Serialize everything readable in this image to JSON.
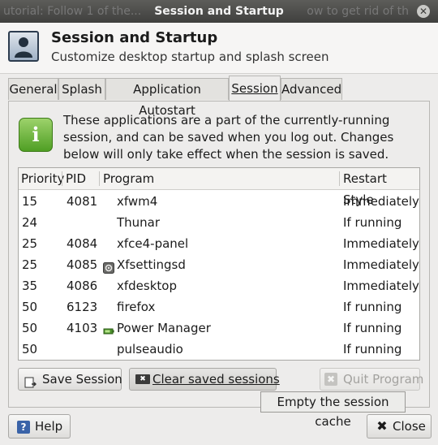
{
  "window": {
    "title": "Session and Startup",
    "behind_left": "utorial: Follow 1 of the...",
    "behind_right": "ow to get rid of th",
    "close_glyph": "✕"
  },
  "header": {
    "title": "Session and Startup",
    "subtitle": "Customize desktop startup and splash screen"
  },
  "tabs": [
    {
      "label": "General",
      "active": false
    },
    {
      "label": "Splash",
      "active": false
    },
    {
      "label": "Application Autostart",
      "active": false
    },
    {
      "label": "Session",
      "active": true
    },
    {
      "label": "Advanced",
      "active": false
    }
  ],
  "info": {
    "icon_glyph": "i",
    "line1": "These applications are a part of the currently-running",
    "line2": "session, and can be saved when you log out.  Changes",
    "line3": "below will only take effect when the session is saved."
  },
  "table": {
    "columns": [
      "Priority",
      "PID",
      "Program",
      "Restart Style"
    ],
    "rows": [
      {
        "priority": "15",
        "pid": "4081",
        "program": "xfwm4",
        "restart": "Immediately",
        "icon": ""
      },
      {
        "priority": "24",
        "pid": "",
        "program": "Thunar",
        "restart": "If running",
        "icon": ""
      },
      {
        "priority": "25",
        "pid": "4084",
        "program": "xfce4-panel",
        "restart": "Immediately",
        "icon": ""
      },
      {
        "priority": "25",
        "pid": "4085",
        "program": "Xfsettingsd",
        "restart": "Immediately",
        "icon": "settings-icon"
      },
      {
        "priority": "35",
        "pid": "4086",
        "program": "xfdesktop",
        "restart": "Immediately",
        "icon": ""
      },
      {
        "priority": "50",
        "pid": "6123",
        "program": "firefox",
        "restart": "If running",
        "icon": ""
      },
      {
        "priority": "50",
        "pid": "4103",
        "program": "Power Manager",
        "restart": "If running",
        "icon": "battery-icon"
      },
      {
        "priority": "50",
        "pid": "",
        "program": "pulseaudio",
        "restart": "If running",
        "icon": ""
      }
    ]
  },
  "buttons": {
    "save_session": "Save Session",
    "clear_sessions": "Clear saved sessions",
    "quit_program": "Quit Program",
    "help": "Help",
    "close": "Close",
    "help_glyph": "?",
    "close_glyph": "✖",
    "clear_glyph": "✖",
    "quit_glyph": "✖"
  },
  "tooltip": {
    "text": "Empty the session cache"
  },
  "colors": {
    "titlebar": "#4b4b49",
    "info_icon": "#6cb83a",
    "help_icon": "#3a63a8"
  }
}
